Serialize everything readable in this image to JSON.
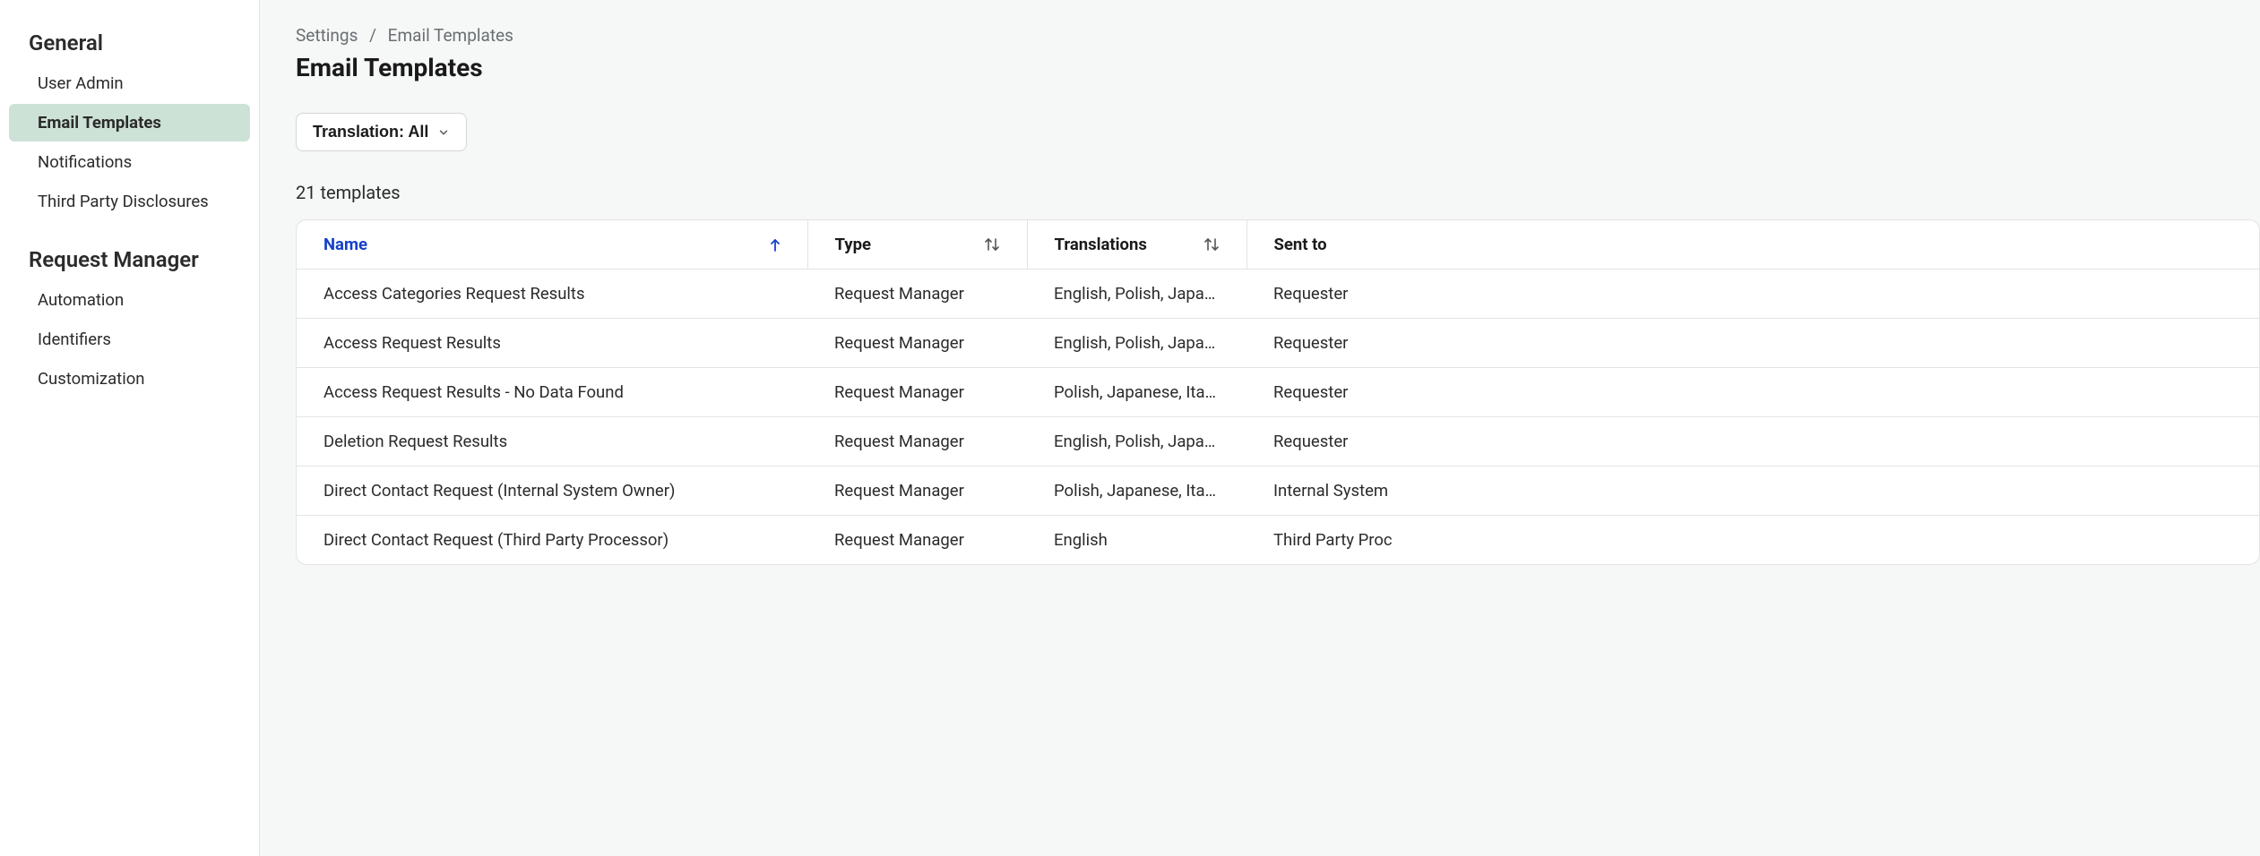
{
  "sidebar": {
    "sections": [
      {
        "heading": "General",
        "items": [
          {
            "label": "User Admin",
            "active": false
          },
          {
            "label": "Email Templates",
            "active": true
          },
          {
            "label": "Notifications",
            "active": false
          },
          {
            "label": "Third Party Disclosures",
            "active": false
          }
        ]
      },
      {
        "heading": "Request Manager",
        "items": [
          {
            "label": "Automation",
            "active": false
          },
          {
            "label": "Identifiers",
            "active": false
          },
          {
            "label": "Customization",
            "active": false
          }
        ]
      }
    ]
  },
  "breadcrumb": {
    "parent": "Settings",
    "current": "Email Templates"
  },
  "page_title": "Email Templates",
  "filter": {
    "label": "Translation: All"
  },
  "count_label": "21 templates",
  "table": {
    "columns": [
      {
        "label": "Name",
        "sorted": "asc"
      },
      {
        "label": "Type",
        "sortable": true
      },
      {
        "label": "Translations",
        "sortable": true
      },
      {
        "label": "Sent to",
        "sortable": false
      }
    ],
    "rows": [
      {
        "name": "Access Categories Request Results",
        "type": "Request Manager",
        "translations": "English, Polish, Japan…",
        "sent_to": "Requester"
      },
      {
        "name": "Access Request Results",
        "type": "Request Manager",
        "translations": "English, Polish, Japan…",
        "sent_to": "Requester"
      },
      {
        "name": "Access Request Results - No Data Found",
        "type": "Request Manager",
        "translations": "Polish, Japanese, Itali…",
        "sent_to": "Requester"
      },
      {
        "name": "Deletion Request Results",
        "type": "Request Manager",
        "translations": "English, Polish, Japan…",
        "sent_to": "Requester"
      },
      {
        "name": "Direct Contact Request (Internal System Owner)",
        "type": "Request Manager",
        "translations": "Polish, Japanese, Itali…",
        "sent_to": "Internal System"
      },
      {
        "name": "Direct Contact Request (Third Party Processor)",
        "type": "Request Manager",
        "translations": "English",
        "sent_to": "Third Party Proc"
      }
    ]
  }
}
